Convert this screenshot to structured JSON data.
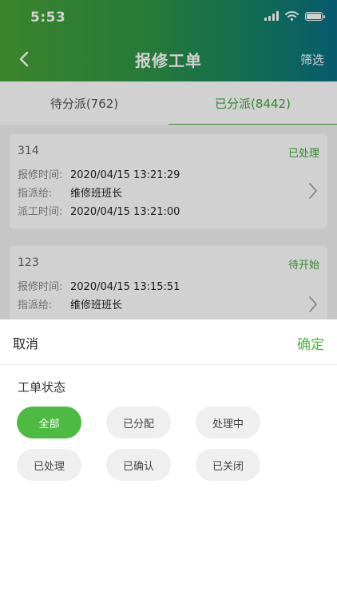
{
  "status_bar": {
    "time": "5:53"
  },
  "nav": {
    "title": "报修工单",
    "filter_label": "筛选"
  },
  "tabs": [
    {
      "label": "待分派(762)",
      "active": false
    },
    {
      "label": "已分派(8442)",
      "active": true
    }
  ],
  "orders": [
    {
      "id": "314",
      "status": "已处理",
      "fields": [
        {
          "label": "报修时间:",
          "value": "2020/04/15 13:21:29"
        },
        {
          "label": "指派给:",
          "value": "维修班班长"
        },
        {
          "label": "派工时间:",
          "value": "2020/04/15 13:21:00"
        }
      ]
    },
    {
      "id": "123",
      "status": "待开始",
      "fields": [
        {
          "label": "报修时间:",
          "value": "2020/04/15 13:15:51"
        },
        {
          "label": "指派给:",
          "value": "维修班班长"
        }
      ]
    }
  ],
  "filter_sheet": {
    "cancel_label": "取消",
    "confirm_label": "确定",
    "section_title": "工单状态",
    "options": [
      {
        "label": "全部",
        "selected": true
      },
      {
        "label": "已分配",
        "selected": false
      },
      {
        "label": "处理中",
        "selected": false
      },
      {
        "label": "已处理",
        "selected": false
      },
      {
        "label": "已确认",
        "selected": false
      },
      {
        "label": "已关闭",
        "selected": false
      }
    ]
  },
  "colors": {
    "accent": "#4cb342",
    "header_start": "#49a236",
    "header_end": "#0a6f86"
  }
}
